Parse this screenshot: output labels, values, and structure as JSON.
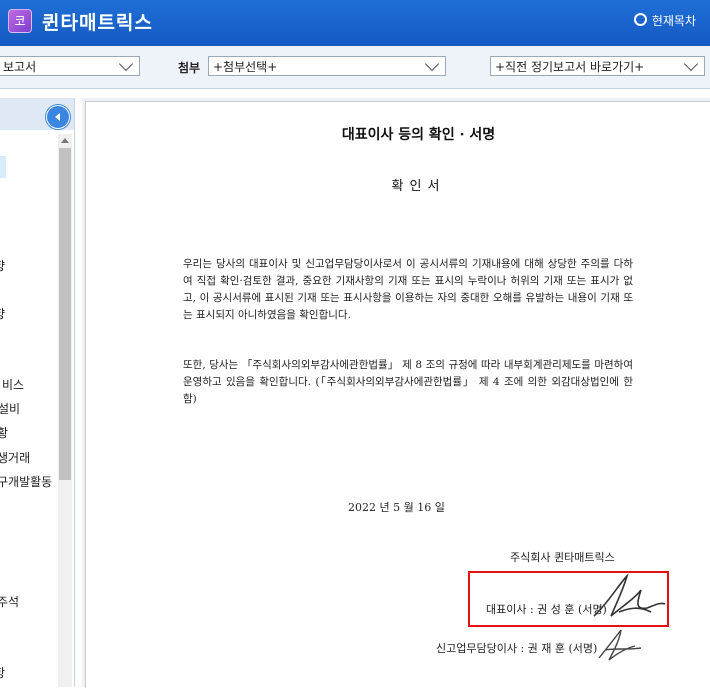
{
  "header": {
    "app_icon_glyph": "코",
    "app_title": "퀸타매트릭스",
    "toc_label": "현재목차"
  },
  "toolbar": {
    "report_select_value": "보고서",
    "attach_label": "첨부",
    "attach_select_value": "+첨부선택+",
    "goto_select_value": "+직전 정기보고서 바로가기+"
  },
  "sidebar": {
    "items": [
      {
        "label": "향"
      },
      {
        "label": "향"
      },
      {
        "label": "비스"
      },
      {
        "label": "설비"
      },
      {
        "label": "황"
      },
      {
        "label": "생거래"
      },
      {
        "label": "구개발활동"
      },
      {
        "label": "주석"
      },
      {
        "label": "항"
      }
    ]
  },
  "document": {
    "title": "대표이사 등의 확인 · 서명",
    "subtitle": "확인서",
    "paragraph1": "우리는 당사의 대표이사 및 신고업무담당이사로서 이 공시서류의 기재내용에 대해 상당한 주의를 다하여 직접 확인·검토한 결과, 중요한 기재사항의 기재 또는 표시의 누락이나 허위의 기재 또는 표시가 없고, 이 공시서류에 표시된 기재 또는 표시사항을 이용하는 자의 중대한 오해를 유발하는 내용이 기재 또는 표시되지 아니하였음을 확인합니다.",
    "paragraph2": "또한, 당사는 「주식회사의외부감사에관한법률」 제 8 조의 규정에 따라 내부회계관리제도를 마련하여 운영하고 있음을 확인합니다. (「주식회사의외부감사에관한법률」 제 4 조에 의한 외감대상법인에 한함)",
    "date": "2022 년  5 월  16 일",
    "company": "주식회사  퀸타매트릭스",
    "signer1": "대표이사 : 권 성 훈 (서명)",
    "signer2": "신고업무담당이사 : 권 재 훈 (서명)"
  },
  "colors": {
    "header_blue": "#1559c2",
    "highlight_red": "#e21212"
  },
  "icons": [
    "app-logo-icon",
    "toc-circle-icon",
    "chevron-down-icon",
    "collapse-left-icon",
    "scroll-up-icon",
    "signature-mark"
  ]
}
